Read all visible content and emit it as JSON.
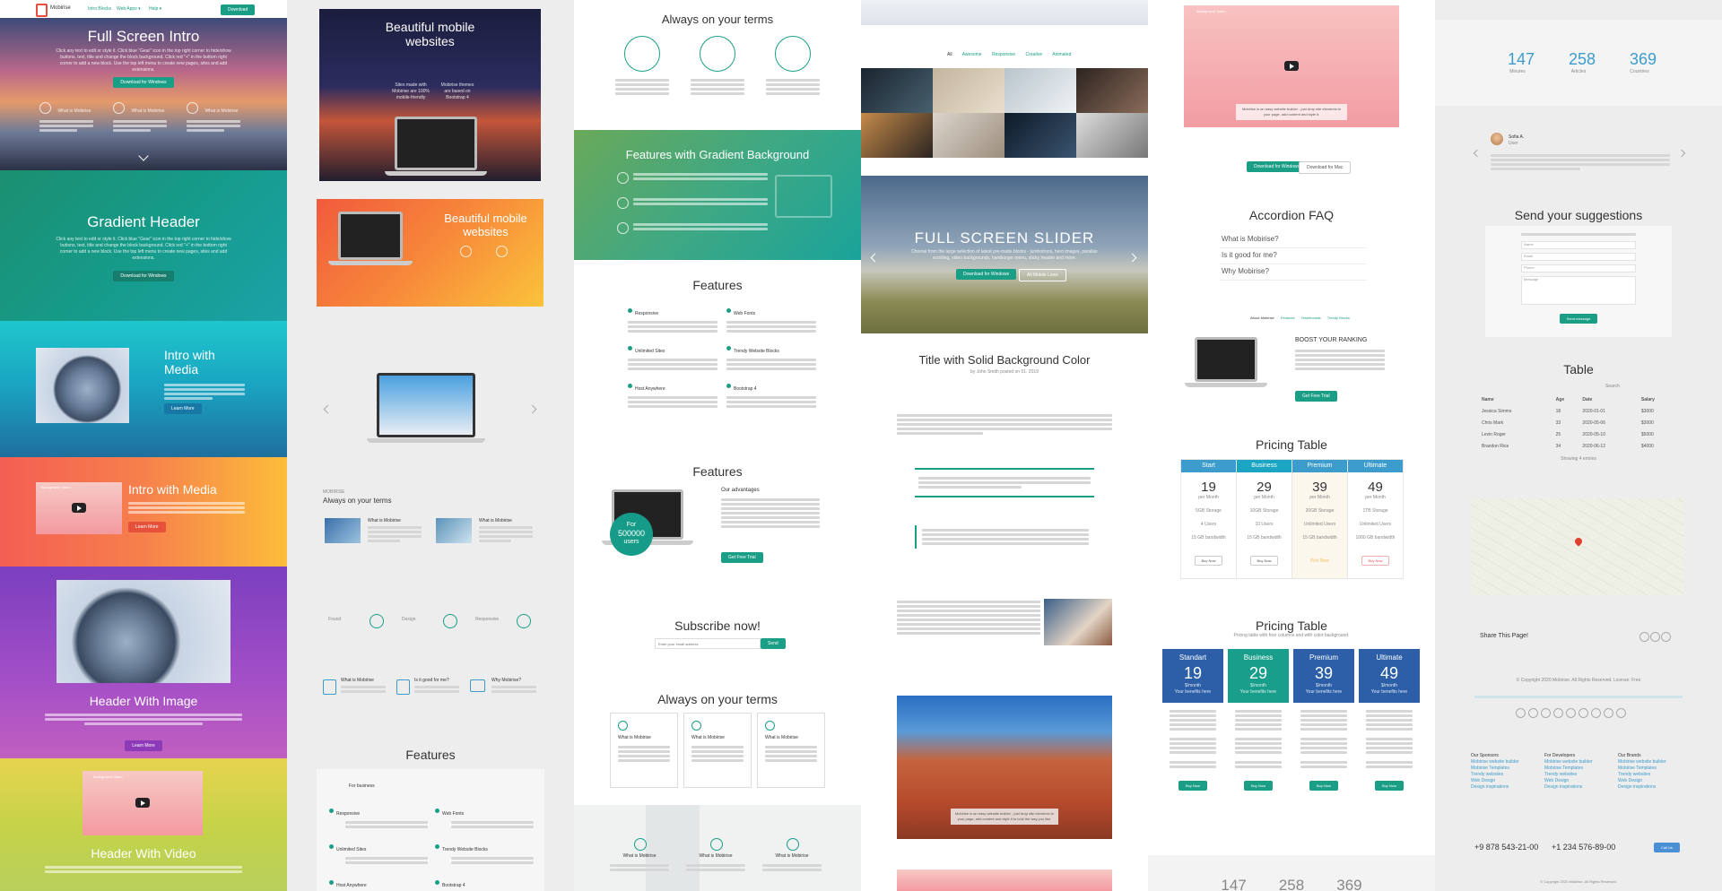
{
  "c1": {
    "nav": {
      "logo": "Mobirise",
      "items": [
        "Intro Blocks",
        "Web Apps ▾",
        "Help ▾"
      ],
      "button": "Download"
    },
    "full_screen_intro": {
      "title": "Full Screen Intro",
      "text": "Click any text to edit or style it. Click blue \"Gear\" icon in the top right corner to hide/show buttons, text, title and change the block background. Click red \"+\" in the bottom right corner to add a new block. Use the top left menu to create new pages, sites and add extensions.",
      "button": "Download for Windows",
      "features": [
        "What is Mobirise",
        "What is Mobirise",
        "What is Mobirise"
      ]
    },
    "gradient_header": {
      "title": "Gradient Header",
      "text": "Click any text to edit or style it. Click blue \"Gear\" icon in the top right corner to hide/show buttons, text, title and change the block background. Click red \"+\" in the bottom right corner to add a new block. Use the top left menu to create new pages, sites and add extensions.",
      "button": "Download for Windows"
    },
    "intro_media_1": {
      "title": "Intro with Media",
      "button": "Learn More"
    },
    "intro_media_2": {
      "title": "Intro with Media",
      "button": "Learn More",
      "video_label": "Background Video"
    },
    "header_image": {
      "title": "Header With Image",
      "button": "Learn More"
    },
    "header_video": {
      "title": "Header With Video",
      "video_label": "Background Video"
    }
  },
  "c2": {
    "mobile1": {
      "title": "Beautiful mobile websites",
      "card1": "Sites made with Mobirise are 100% mobile-friendly",
      "card2": "Mobirise themes are based on Bootstrap 4"
    },
    "mobile2": {
      "title": "Beautiful mobile websites"
    },
    "terms": {
      "kicker": "MOBIRISE",
      "title": "Always on your terms",
      "items": [
        "What is Mobirise",
        "What is Mobirise"
      ]
    },
    "steps": [
      "Found",
      "Design",
      "Responsive"
    ],
    "icons_row": [
      "What is Mobirise",
      "Is it good for me?",
      "Why Mobirise?"
    ],
    "features": {
      "title": "Features",
      "kicker": "For business",
      "items": [
        "Responsive",
        "Web Fonts",
        "Unlimited Sites",
        "Trendy Website Blocks",
        "Host Anywhere",
        "Bootstrap 4"
      ]
    }
  },
  "c3": {
    "terms": {
      "title": "Always on your terms"
    },
    "gradient": {
      "title": "Features with Gradient Background"
    },
    "features1": {
      "title": "Features",
      "items": [
        "Responsive",
        "Web Fonts",
        "Unlimited Sites",
        "Trendy Website Blocks",
        "Host Anywhere",
        "Bootstrap 4"
      ]
    },
    "features2": {
      "title": "Features",
      "badge_line1": "For",
      "badge_line2": "500000",
      "badge_line3": "users",
      "heading": "Our advantages",
      "button": "Get Free Trial"
    },
    "subscribe": {
      "title": "Subscribe now!",
      "placeholder": "Enter your email address",
      "button": "Send"
    },
    "terms2": {
      "title": "Always on your terms",
      "items": [
        "What is Mobirise",
        "What is Mobirise",
        "What is Mobirise"
      ]
    },
    "bottom": {
      "items": [
        "What is Mobirise",
        "What is Mobirise",
        "What is Mobirise"
      ]
    }
  },
  "c4": {
    "gallery_tabs": [
      "All",
      "Awesome",
      "Responsive",
      "Creative",
      "Animated"
    ],
    "slider": {
      "title": "FULL SCREEN SLIDER",
      "text": "Choose from the large selection of latest pre-made blocks - jumbotrons, hero images, parallax scrolling, video backgrounds, hamburger menu, sticky header and more.",
      "btn1": "Download for Windows",
      "btn2": "All Mobile Lives"
    },
    "article": {
      "title": "Title with Solid Background Color",
      "byline": "by John Smith posted on 01. 2019"
    },
    "photo_caption": "Mobirise is an easy website builder - just drop site elements to your page, add content and style it to look the way you like."
  },
  "c5": {
    "video_caption": "Mobirise is an easy website builder - just drop site elements to your page, add content and style it.",
    "video_label": "Background Video",
    "btn1": "Download for Windows",
    "btn2": "Download for Mac",
    "faq": {
      "title": "Accordion FAQ",
      "items": [
        "What is Mobirise?",
        "Is it good for me?",
        "Why Mobirise?"
      ]
    },
    "tabs": [
      "About Mobirise",
      "Features",
      "Testimonials",
      "Trendy Blocks"
    ],
    "boost": {
      "title": "BOOST YOUR RANKING",
      "button": "Get Free Trial"
    },
    "pricing1": {
      "title": "Pricing Table",
      "plans": [
        {
          "name": "Start",
          "price": "19",
          "per": "per Month"
        },
        {
          "name": "Business",
          "price": "29",
          "per": "per Month"
        },
        {
          "name": "Premium",
          "price": "39",
          "per": "per Month"
        },
        {
          "name": "Ultimate",
          "price": "49",
          "per": "per Month"
        }
      ],
      "rows": [
        [
          "5GB Storage",
          "10GB Storage",
          "20GB Storage",
          "1TB Storage"
        ],
        [
          "4 Users",
          "10 Users",
          "Unlimited Users",
          "Unlimited Users"
        ],
        [
          "15 GB bandwidth",
          "15 GB bandwidth",
          "15 GB bandwidth",
          "1000 GB bandwidth"
        ]
      ],
      "button": "Buy Now",
      "pick": "Pick Now"
    },
    "pricing2": {
      "title": "Pricing Table",
      "subtitle": "Pricing table with four columns and with color background.",
      "plans": [
        {
          "name": "Standart",
          "price": "19",
          "period": "$/month",
          "note": "Your benefits here"
        },
        {
          "name": "Business",
          "price": "29",
          "period": "$/month",
          "note": "Your benefits here"
        },
        {
          "name": "Premium",
          "price": "39",
          "period": "$/month",
          "note": "Your benefits here"
        },
        {
          "name": "Ultimate",
          "price": "49",
          "period": "$/month",
          "note": "Your benefits here"
        }
      ],
      "button": "Buy Now"
    },
    "stats": [
      "147",
      "258",
      "369"
    ]
  },
  "c6": {
    "stats": [
      {
        "value": "147",
        "label": "Minutes"
      },
      {
        "value": "258",
        "label": "Articles"
      },
      {
        "value": "369",
        "label": "Countries"
      }
    ],
    "testimonial": {
      "name": "Sofia A.",
      "role": "User"
    },
    "suggestions": {
      "title": "Send your suggestions",
      "fields": [
        "Name",
        "Email",
        "Phone",
        "Message"
      ],
      "button": "Send message"
    },
    "table": {
      "title": "Table",
      "search": "Search",
      "headers": [
        "Name",
        "Age",
        "Date",
        "Salary"
      ],
      "rows": [
        [
          "Jessica Simms",
          "18",
          "2020-01-01",
          "$3000"
        ],
        [
          "Chris Mark",
          "33",
          "2020-05-06",
          "$3000"
        ],
        [
          "Levin Roger",
          "25",
          "2020-05-10",
          "$5000"
        ],
        [
          "Brandon Rice",
          "34",
          "2020-06-12",
          "$4000"
        ]
      ],
      "footer": "Showing 4 entries"
    },
    "share": {
      "title": "Share This Page!"
    },
    "copyright1": "© Copyright 2020 Mobirise. All Rights Reserved. License: Free",
    "footer_cols": [
      {
        "title": "Our Sponsors",
        "items": [
          "Mobirise website builder",
          "Mobirise Templates",
          "Trendy websites",
          "Web Design",
          "Design inspirations"
        ]
      },
      {
        "title": "For Developers",
        "items": [
          "Mobirise website builder",
          "Mobirise Templates",
          "Trendy websites",
          "Web Design",
          "Design inspirations"
        ]
      },
      {
        "title": "Our Brands",
        "items": [
          "Mobirise website builder",
          "Mobirise Templates",
          "Trendy websites",
          "Web Design",
          "Design inspirations"
        ]
      }
    ],
    "phone1": "+9 878 543-21-00",
    "phone2": "+1 234 576-89-00",
    "callus": "Call Us",
    "copyright2": "© Copyright 2020 Mobirise. All Rights Reserved."
  }
}
